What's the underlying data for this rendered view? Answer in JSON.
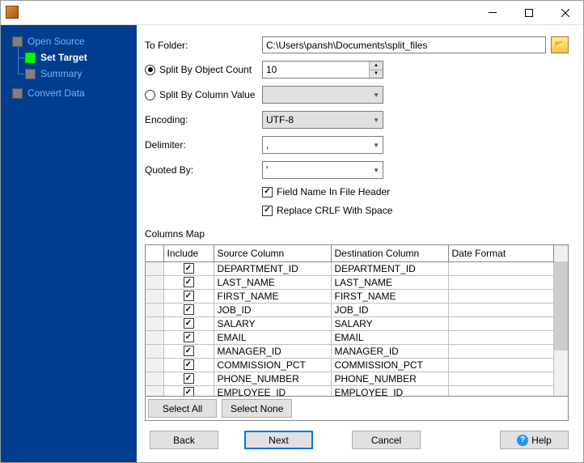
{
  "sidebar": {
    "items": [
      {
        "label": "Open Source",
        "active": false
      },
      {
        "label": "Set Target",
        "active": true
      },
      {
        "label": "Summary",
        "active": false
      },
      {
        "label": "Convert Data",
        "active": false
      }
    ]
  },
  "form": {
    "to_folder_label": "To Folder:",
    "to_folder_value": "C:\\Users\\pansh\\Documents\\split_files",
    "split_by_count_label": "Split By Object Count",
    "split_by_count_value": "10",
    "split_by_column_label": "Split By Column Value",
    "split_by_column_value": "",
    "encoding_label": "Encoding:",
    "encoding_value": "UTF-8",
    "delimiter_label": "Delimiter:",
    "delimiter_value": ",",
    "quoted_by_label": "Quoted By:",
    "quoted_by_value": "'",
    "field_in_header_label": "Field Name In File Header",
    "replace_crlf_label": "Replace CRLF With Space"
  },
  "columns_map": {
    "title": "Columns Map",
    "headers": {
      "include": "Include",
      "source": "Source Column",
      "dest": "Destination Column",
      "date": "Date Format"
    },
    "rows": [
      {
        "include": true,
        "source": "DEPARTMENT_ID",
        "dest": "DEPARTMENT_ID",
        "date": ""
      },
      {
        "include": true,
        "source": "LAST_NAME",
        "dest": "LAST_NAME",
        "date": ""
      },
      {
        "include": true,
        "source": "FIRST_NAME",
        "dest": "FIRST_NAME",
        "date": ""
      },
      {
        "include": true,
        "source": "JOB_ID",
        "dest": "JOB_ID",
        "date": ""
      },
      {
        "include": true,
        "source": "SALARY",
        "dest": "SALARY",
        "date": ""
      },
      {
        "include": true,
        "source": "EMAIL",
        "dest": "EMAIL",
        "date": ""
      },
      {
        "include": true,
        "source": "MANAGER_ID",
        "dest": "MANAGER_ID",
        "date": ""
      },
      {
        "include": true,
        "source": "COMMISSION_PCT",
        "dest": "COMMISSION_PCT",
        "date": ""
      },
      {
        "include": true,
        "source": "PHONE_NUMBER",
        "dest": "PHONE_NUMBER",
        "date": ""
      },
      {
        "include": true,
        "source": "EMPLOYEE_ID",
        "dest": "EMPLOYEE_ID",
        "date": ""
      }
    ],
    "select_all": "Select All",
    "select_none": "Select None"
  },
  "buttons": {
    "back": "Back",
    "next": "Next",
    "cancel": "Cancel",
    "help": "Help"
  }
}
